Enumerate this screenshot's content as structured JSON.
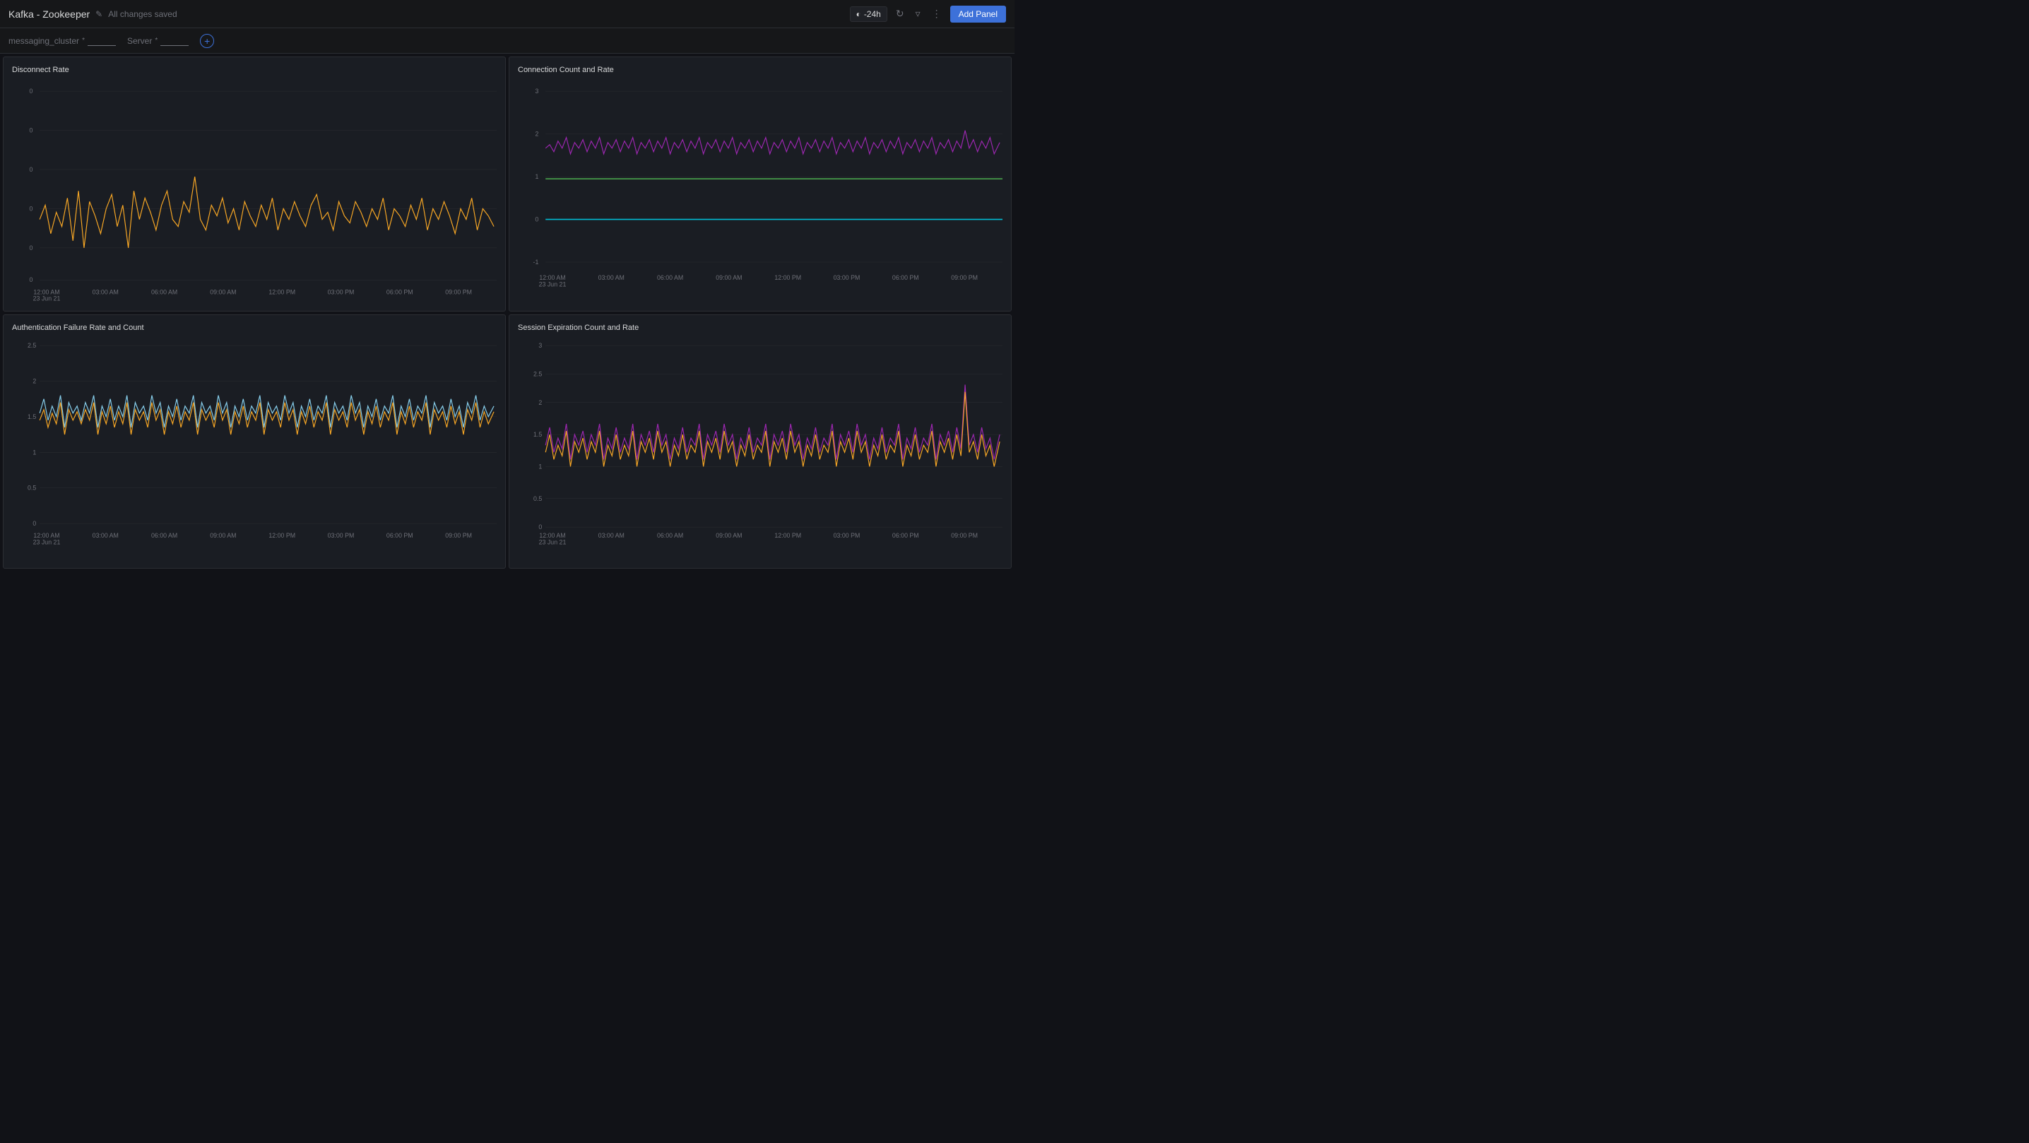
{
  "header": {
    "title": "Kafka - Zookeeper",
    "saved_status": "All changes saved",
    "time_range": "-24h",
    "add_panel_label": "Add Panel"
  },
  "toolbar": {
    "filter1_label": "messaging_cluster",
    "filter1_value": "",
    "filter1_asterisk": "*",
    "filter2_label": "Server",
    "filter2_value": "",
    "filter2_asterisk": "*"
  },
  "panels": [
    {
      "id": "disconnect-rate",
      "title": "Disconnect Rate",
      "color": "#f9a825",
      "yMin": "0",
      "yMax": "0",
      "xLabels": [
        "12:00 AM\n23 Jun 21",
        "03:00 AM",
        "06:00 AM",
        "09:00 AM",
        "12:00 PM",
        "03:00 PM",
        "06:00 PM",
        "09:00 PM"
      ]
    },
    {
      "id": "connection-count-rate",
      "title": "Connection Count and Rate",
      "colors": [
        "#9c27b0",
        "#69c",
        "#4caf50"
      ],
      "yLabels": [
        "3",
        "2",
        "1",
        "0",
        "-1"
      ],
      "xLabels": [
        "12:00 AM\n23 Jun 21",
        "03:00 AM",
        "06:00 AM",
        "09:00 AM",
        "12:00 PM",
        "03:00 PM",
        "06:00 PM",
        "09:00 PM"
      ]
    },
    {
      "id": "auth-failure",
      "title": "Authentication Failure Rate and Count",
      "colors": [
        "#87ceeb",
        "#f9a825"
      ],
      "yLabels": [
        "2.5",
        "2",
        "1.5",
        "1",
        "0.5",
        "0"
      ],
      "xLabels": [
        "12:00 AM\n23 Jun 21",
        "03:00 AM",
        "06:00 AM",
        "09:00 AM",
        "12:00 PM",
        "03:00 PM",
        "06:00 PM",
        "09:00 PM"
      ]
    },
    {
      "id": "session-expiration",
      "title": "Session Expiration Count and Rate",
      "colors": [
        "#9c27b0",
        "#f9a825"
      ],
      "yLabels": [
        "3",
        "2.5",
        "2",
        "1.5",
        "1",
        "0.5",
        "0"
      ],
      "xLabels": [
        "12:00 AM\n23 Jun 21",
        "03:00 AM",
        "06:00 AM",
        "09:00 AM",
        "12:00 PM",
        "03:00 PM",
        "06:00 PM",
        "09:00 PM"
      ]
    }
  ]
}
